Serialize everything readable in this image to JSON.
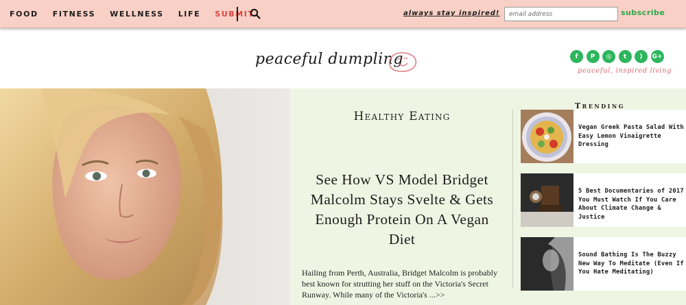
{
  "nav": {
    "items": [
      "FOOD",
      "FITNESS",
      "WELLNESS",
      "LIFE"
    ],
    "submit": "SUBMIT"
  },
  "topbar": {
    "tagline": "always stay inspired!",
    "email_placeholder": "email address",
    "subscribe_label": "subscribe"
  },
  "header": {
    "logo_text": "peaceful dumpling",
    "social_icons": [
      "facebook-icon",
      "pinterest-icon",
      "instagram-icon",
      "twitter-icon",
      "rss-icon",
      "google-plus-icon"
    ],
    "social_glyphs": [
      "f",
      "P",
      "◎",
      "t",
      ")",
      "G+"
    ],
    "social_tagline": "peaceful, inspired living"
  },
  "feature": {
    "category": "Healthy Eating",
    "title": "See How VS Model Bridget Malcolm Stays Svelte & Gets Enough Protein On A Vegan Diet",
    "excerpt": "Hailing from Perth, Australia, Bridget Malcolm is probably best known for strutting her stuff on the Victoria's Secret Runway. While many of the Victoria's ...>>"
  },
  "trending": {
    "heading": "Trending",
    "items": [
      {
        "title": "Vegan Greek Pasta Salad With Easy Lemon Vinaigrette Dressing"
      },
      {
        "title": "5 Best Documentaries of 2017 You Must Watch If You Care About Climate Change & Justice"
      },
      {
        "title": "Sound Bathing Is The Buzzy New Way To Meditate (Even If You Hate Meditating)"
      }
    ]
  },
  "colors": {
    "topbar_bg": "#f9d0c6",
    "accent_red": "#d9443f",
    "brand_green": "#2db65d",
    "panel_bg": "#eff5e3",
    "tagline_pink": "#e06a6f"
  }
}
